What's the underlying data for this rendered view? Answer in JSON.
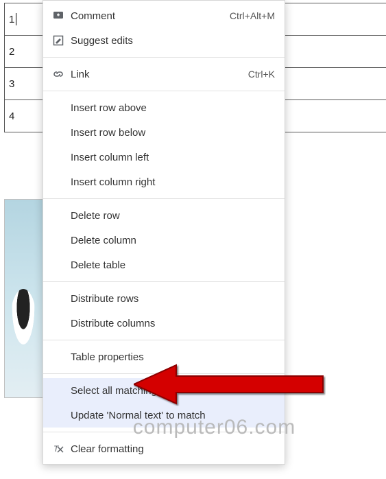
{
  "table_rows": [
    "1",
    "2",
    "3",
    "4"
  ],
  "menu": {
    "comment": {
      "label": "Comment",
      "shortcut": "Ctrl+Alt+M"
    },
    "suggest": {
      "label": "Suggest edits"
    },
    "link": {
      "label": "Link",
      "shortcut": "Ctrl+K"
    },
    "insert_row_above": "Insert row above",
    "insert_row_below": "Insert row below",
    "insert_col_left": "Insert column left",
    "insert_col_right": "Insert column right",
    "delete_row": "Delete row",
    "delete_column": "Delete column",
    "delete_table": "Delete table",
    "distribute_rows": "Distribute rows",
    "distribute_columns": "Distribute columns",
    "table_properties": "Table properties",
    "select_matching": "Select all matching text",
    "update_normal": "Update 'Normal text' to match",
    "clear_formatting": "Clear formatting"
  },
  "watermark": "computer06.com"
}
